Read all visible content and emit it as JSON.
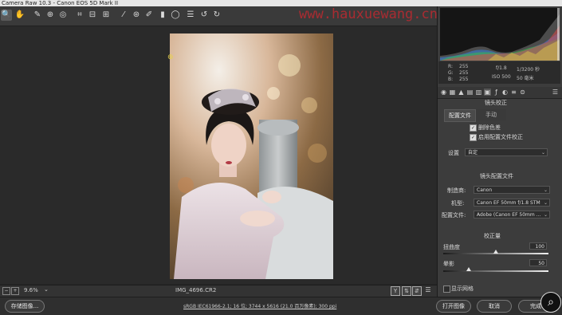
{
  "window": {
    "title": "Camera Raw 10.3 - Canon EOS 5D Mark II"
  },
  "watermark": "www.hauxuewang.cn",
  "colors": {
    "accent": "#e9d24d",
    "watermark": "#d8262e",
    "panel": "#3c3c3c"
  },
  "toolbar": {
    "tools": [
      {
        "icon": "zoom-icon",
        "glyph": "🔍"
      },
      {
        "icon": "hand-icon",
        "glyph": "✋"
      },
      {
        "icon": "white-balance-icon",
        "glyph": "✎"
      },
      {
        "icon": "color-sampler-icon",
        "glyph": "⊕"
      },
      {
        "icon": "targeted-adjust-icon",
        "glyph": "◎"
      },
      {
        "icon": "crop-icon",
        "glyph": "⌗"
      },
      {
        "icon": "straighten-icon",
        "glyph": "⊟"
      },
      {
        "icon": "transform-icon",
        "glyph": "⊞"
      },
      {
        "icon": "spot-removal-icon",
        "glyph": "⁄"
      },
      {
        "icon": "red-eye-icon",
        "glyph": "⊛"
      },
      {
        "icon": "adjustment-brush-icon",
        "glyph": "✐"
      },
      {
        "icon": "graduated-filter-icon",
        "glyph": "▮"
      },
      {
        "icon": "radial-filter-icon",
        "glyph": "◯"
      },
      {
        "icon": "preferences-icon",
        "glyph": "☰"
      },
      {
        "icon": "rotate-left-icon",
        "glyph": "↺"
      },
      {
        "icon": "rotate-right-icon",
        "glyph": "↻"
      }
    ]
  },
  "status": {
    "zoom": "9.6%",
    "filename": "IMG_4696.CR2"
  },
  "bottom": {
    "save_label": "存储图像...",
    "workflow_link": "sRGB IEC61966-2.1; 16 位; 3744 x 5616 (21.0 百万像素); 300 ppi",
    "open_label": "打开图像",
    "cancel_label": "取消",
    "done_label": "完成"
  },
  "histogram": {
    "r_label": "R:",
    "r_value": "255",
    "g_label": "G:",
    "g_value": "255",
    "b_label": "B:",
    "b_value": "255",
    "aperture": "f/1.8",
    "shutter": "1/3200 秒",
    "iso": "ISO 500",
    "focal": "50 毫米"
  },
  "panel": {
    "section_title": "镜头校正",
    "tab_profile": "配置文件",
    "tab_manual": "手动",
    "chk_remove_ca": "删除色差",
    "chk_enable_profile": "启用配置文件校正",
    "setup_label": "设置",
    "setup_value": "自定",
    "lens_profile_title": "镜头配置文件",
    "make_label": "制造商:",
    "make_value": "Canon",
    "model_label": "机型:",
    "model_value": "Canon EF 50mm f/1.8 STM",
    "profile_label": "配置文件:",
    "profile_value": "Adobe (Canon EF 50mm ...",
    "correction_title": "校正量",
    "distortion_label": "扭曲度",
    "distortion_value": "100",
    "vignette_label": "晕影",
    "vignette_value": "50",
    "show_grid_label": "显示网格"
  }
}
